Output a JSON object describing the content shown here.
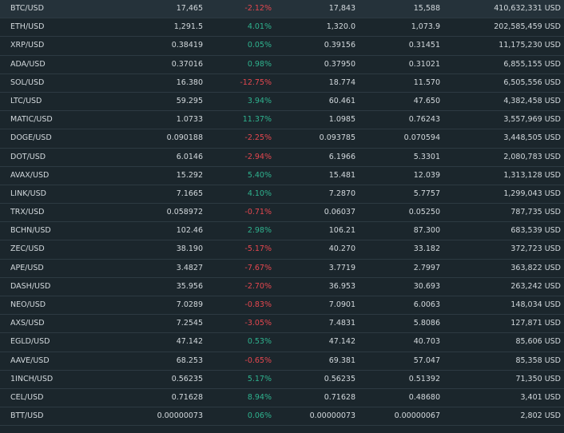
{
  "colors": {
    "background": "#1b262c",
    "row_selected": "#25323a",
    "divider": "#2d3a42",
    "text": "#d3d9dd",
    "positive": "#2fb38f",
    "negative": "#e5474f"
  },
  "rows": [
    {
      "pair": "BTC/USD",
      "last": "17,465",
      "change": "-2.12%",
      "dir": "down",
      "high": "17,843",
      "low": "15,588",
      "volume": "410,632,331 USD"
    },
    {
      "pair": "ETH/USD",
      "last": "1,291.5",
      "change": "4.01%",
      "dir": "up",
      "high": "1,320.0",
      "low": "1,073.9",
      "volume": "202,585,459 USD"
    },
    {
      "pair": "XRP/USD",
      "last": "0.38419",
      "change": "0.05%",
      "dir": "up",
      "high": "0.39156",
      "low": "0.31451",
      "volume": "11,175,230 USD"
    },
    {
      "pair": "ADA/USD",
      "last": "0.37016",
      "change": "0.98%",
      "dir": "up",
      "high": "0.37950",
      "low": "0.31021",
      "volume": "6,855,155 USD"
    },
    {
      "pair": "SOL/USD",
      "last": "16.380",
      "change": "-12.75%",
      "dir": "down",
      "high": "18.774",
      "low": "11.570",
      "volume": "6,505,556 USD"
    },
    {
      "pair": "LTC/USD",
      "last": "59.295",
      "change": "3.94%",
      "dir": "up",
      "high": "60.461",
      "low": "47.650",
      "volume": "4,382,458 USD"
    },
    {
      "pair": "MATIC/USD",
      "last": "1.0733",
      "change": "11.37%",
      "dir": "up",
      "high": "1.0985",
      "low": "0.76243",
      "volume": "3,557,969 USD"
    },
    {
      "pair": "DOGE/USD",
      "last": "0.090188",
      "change": "-2.25%",
      "dir": "down",
      "high": "0.093785",
      "low": "0.070594",
      "volume": "3,448,505 USD"
    },
    {
      "pair": "DOT/USD",
      "last": "6.0146",
      "change": "-2.94%",
      "dir": "down",
      "high": "6.1966",
      "low": "5.3301",
      "volume": "2,080,783 USD"
    },
    {
      "pair": "AVAX/USD",
      "last": "15.292",
      "change": "5.40%",
      "dir": "up",
      "high": "15.481",
      "low": "12.039",
      "volume": "1,313,128 USD"
    },
    {
      "pair": "LINK/USD",
      "last": "7.1665",
      "change": "4.10%",
      "dir": "up",
      "high": "7.2870",
      "low": "5.7757",
      "volume": "1,299,043 USD"
    },
    {
      "pair": "TRX/USD",
      "last": "0.058972",
      "change": "-0.71%",
      "dir": "down",
      "high": "0.06037",
      "low": "0.05250",
      "volume": "787,735 USD"
    },
    {
      "pair": "BCHN/USD",
      "last": "102.46",
      "change": "2.98%",
      "dir": "up",
      "high": "106.21",
      "low": "87.300",
      "volume": "683,539 USD"
    },
    {
      "pair": "ZEC/USD",
      "last": "38.190",
      "change": "-5.17%",
      "dir": "down",
      "high": "40.270",
      "low": "33.182",
      "volume": "372,723 USD"
    },
    {
      "pair": "APE/USD",
      "last": "3.4827",
      "change": "-7.67%",
      "dir": "down",
      "high": "3.7719",
      "low": "2.7997",
      "volume": "363,822 USD"
    },
    {
      "pair": "DASH/USD",
      "last": "35.956",
      "change": "-2.70%",
      "dir": "down",
      "high": "36.953",
      "low": "30.693",
      "volume": "263,242 USD"
    },
    {
      "pair": "NEO/USD",
      "last": "7.0289",
      "change": "-0.83%",
      "dir": "down",
      "high": "7.0901",
      "low": "6.0063",
      "volume": "148,034 USD"
    },
    {
      "pair": "AXS/USD",
      "last": "7.2545",
      "change": "-3.05%",
      "dir": "down",
      "high": "7.4831",
      "low": "5.8086",
      "volume": "127,871 USD"
    },
    {
      "pair": "EGLD/USD",
      "last": "47.142",
      "change": "0.53%",
      "dir": "up",
      "high": "47.142",
      "low": "40.703",
      "volume": "85,606 USD"
    },
    {
      "pair": "AAVE/USD",
      "last": "68.253",
      "change": "-0.65%",
      "dir": "down",
      "high": "69.381",
      "low": "57.047",
      "volume": "85,358 USD"
    },
    {
      "pair": "1INCH/USD",
      "last": "0.56235",
      "change": "5.17%",
      "dir": "up",
      "high": "0.56235",
      "low": "0.51392",
      "volume": "71,350 USD"
    },
    {
      "pair": "CEL/USD",
      "last": "0.71628",
      "change": "8.94%",
      "dir": "up",
      "high": "0.71628",
      "low": "0.48680",
      "volume": "3,401 USD"
    },
    {
      "pair": "BTT/USD",
      "last": "0.00000073",
      "change": "0.06%",
      "dir": "up",
      "high": "0.00000073",
      "low": "0.00000067",
      "volume": "2,802 USD"
    }
  ]
}
